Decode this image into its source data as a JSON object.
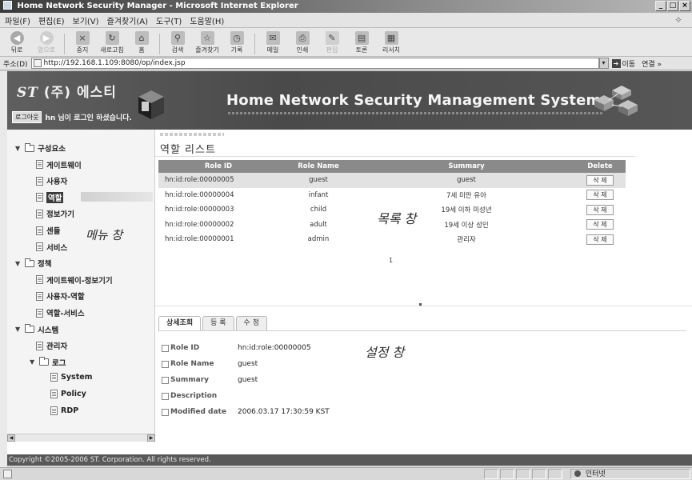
{
  "window": {
    "title": "Home Network Security Manager - Microsoft Internet Explorer",
    "controls": [
      "_",
      "□",
      "×"
    ]
  },
  "menubar": [
    "파일(F)",
    "편집(E)",
    "보기(V)",
    "즐겨찾기(A)",
    "도구(T)",
    "도움말(H)"
  ],
  "toolbar": [
    {
      "label": "뒤로",
      "icon": "back-icon",
      "glyph": "◀"
    },
    {
      "label": "앞으로",
      "icon": "forward-icon",
      "glyph": "▶",
      "disabled": true
    },
    {
      "label": "중지",
      "icon": "stop-icon",
      "glyph": "×"
    },
    {
      "label": "새로고침",
      "icon": "refresh-icon",
      "glyph": "↻"
    },
    {
      "label": "홈",
      "icon": "home-icon",
      "glyph": "⌂"
    },
    {
      "label": "검색",
      "icon": "search-icon",
      "glyph": "⚲"
    },
    {
      "label": "즐겨찾기",
      "icon": "favorites-icon",
      "glyph": "☆"
    },
    {
      "label": "기록",
      "icon": "history-icon",
      "glyph": "◷"
    },
    {
      "label": "메일",
      "icon": "mail-icon",
      "glyph": "✉"
    },
    {
      "label": "인쇄",
      "icon": "print-icon",
      "glyph": "⎙"
    },
    {
      "label": "편집",
      "icon": "edit-icon",
      "glyph": "✎",
      "disabled": true
    },
    {
      "label": "토론",
      "icon": "discuss-icon",
      "glyph": "▤"
    },
    {
      "label": "리서치",
      "icon": "research-icon",
      "glyph": "▦"
    }
  ],
  "address": {
    "label": "주소(D)",
    "url": "http://192.168.1.109:8080/op/index.jsp",
    "go_label": "이동",
    "links_label": "연결 »"
  },
  "banner": {
    "logo_mark": "ST",
    "logo_text": "(주) 에스티",
    "logout_label": "로그아웃",
    "login_message": "hn 님이 로그인 하셨습니다.",
    "title": "Home Network Security Management System"
  },
  "menu": {
    "annotation": "메뉴 창",
    "items": [
      {
        "label": "구성요소",
        "type": "folder",
        "level": 0,
        "expanded": true
      },
      {
        "label": "게이트웨이",
        "type": "doc",
        "level": 1
      },
      {
        "label": "사용자",
        "type": "doc",
        "level": 1
      },
      {
        "label": "역할",
        "type": "doc",
        "level": 1,
        "selected": true
      },
      {
        "label": "정보가기",
        "type": "doc",
        "level": 1
      },
      {
        "label": "센들",
        "type": "doc",
        "level": 1
      },
      {
        "label": "서비스",
        "type": "doc",
        "level": 1
      },
      {
        "label": "정책",
        "type": "folder",
        "level": 0,
        "expanded": true
      },
      {
        "label": "게이트웨이-정보기기",
        "type": "doc",
        "level": 1
      },
      {
        "label": "사용자-역할",
        "type": "doc",
        "level": 1
      },
      {
        "label": "역할-서비스",
        "type": "doc",
        "level": 1
      },
      {
        "label": "시스템",
        "type": "folder",
        "level": 0,
        "expanded": true
      },
      {
        "label": "관리자",
        "type": "doc",
        "level": 1
      },
      {
        "label": "로그",
        "type": "folder",
        "level": 1,
        "expanded": true
      },
      {
        "label": "System",
        "type": "doc",
        "level": 2
      },
      {
        "label": "Policy",
        "type": "doc",
        "level": 2
      },
      {
        "label": "RDP",
        "type": "doc",
        "level": 2
      }
    ]
  },
  "role_list": {
    "title": "역할 리스트",
    "annotation": "목록 창",
    "columns": [
      "Role ID",
      "Role Name",
      "Summary",
      "Delete"
    ],
    "delete_label": "삭 제",
    "rows": [
      {
        "id": "hn:id:role:00000005",
        "name": "guest",
        "summary": "guest",
        "selected": true
      },
      {
        "id": "hn:id:role:00000004",
        "name": "infant",
        "summary": "7세 미만 유아"
      },
      {
        "id": "hn:id:role:00000003",
        "name": "child",
        "summary": "19세 이하 미성년"
      },
      {
        "id": "hn:id:role:00000002",
        "name": "adult",
        "summary": "19세 이상 성인"
      },
      {
        "id": "hn:id:role:00000001",
        "name": "admin",
        "summary": "관리자"
      }
    ],
    "page": "1"
  },
  "settings": {
    "annotation": "설정 창",
    "tabs": [
      {
        "label": "상세조회",
        "active": true
      },
      {
        "label": "등 록"
      },
      {
        "label": "수 정"
      }
    ],
    "fields": [
      {
        "label": "Role ID",
        "value": "hn:id:role:00000005"
      },
      {
        "label": "Role Name",
        "value": "guest"
      },
      {
        "label": "Summary",
        "value": "guest"
      },
      {
        "label": "Description",
        "value": ""
      },
      {
        "label": "Modified date",
        "value": "2006.03.17 17:30:59 KST"
      }
    ]
  },
  "footer": {
    "copyright": "Copyright ©2005-2006 ST. Corporation. All rights reserved."
  },
  "statusbar": {
    "zone": "인터넷"
  }
}
